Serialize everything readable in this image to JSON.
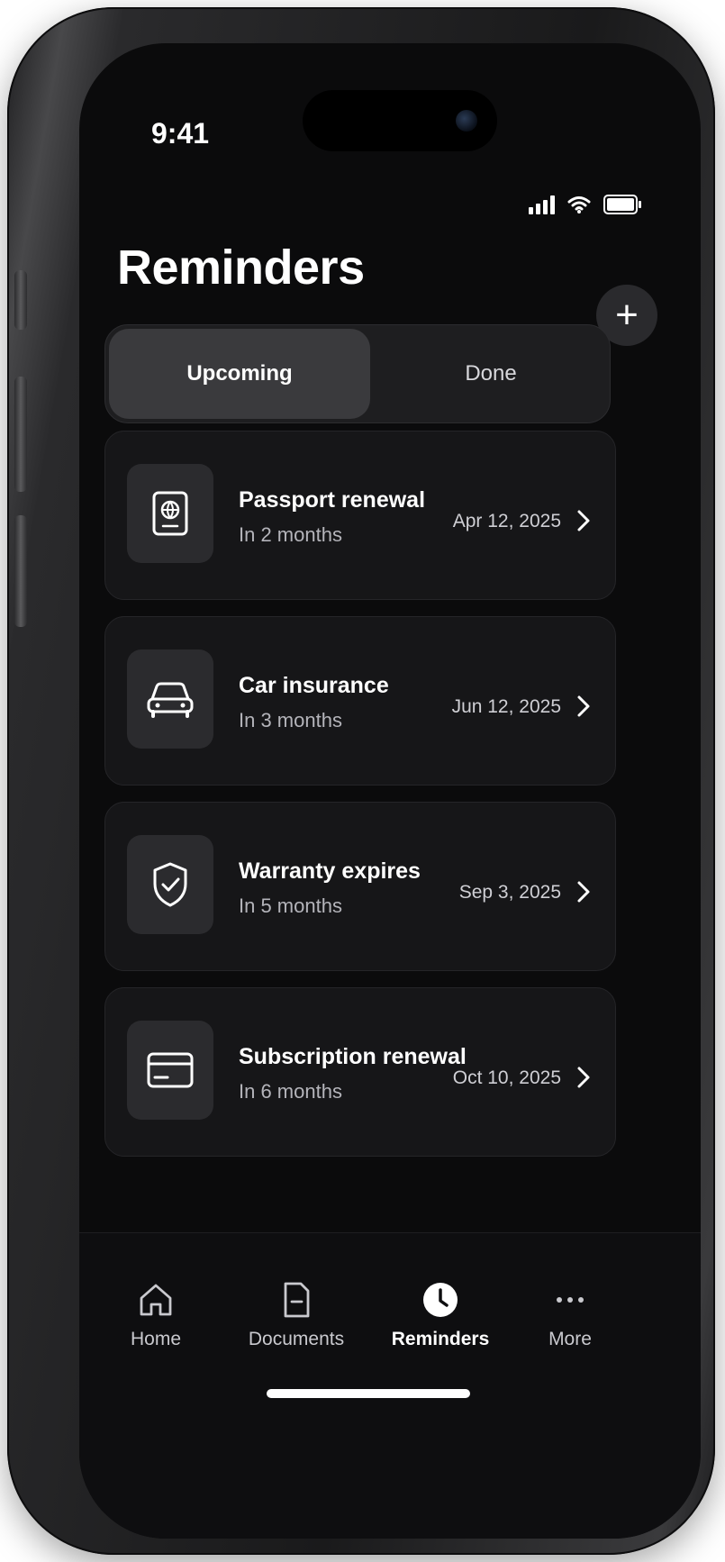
{
  "status": {
    "time": "9:41"
  },
  "header": {
    "title": "Reminders",
    "add_symbol": "+"
  },
  "segments": {
    "upcoming": "Upcoming",
    "done": "Done"
  },
  "reminders": [
    {
      "icon": "passport-icon",
      "title": "Passport renewal",
      "subtitle": "In 2 months",
      "date": "Apr 12, 2025"
    },
    {
      "icon": "car-icon",
      "title": "Car insurance",
      "subtitle": "In 3 months",
      "date": "Jun 12, 2025"
    },
    {
      "icon": "shield-check-icon",
      "title": "Warranty expires",
      "subtitle": "In 5 months",
      "date": "Sep 3, 2025"
    },
    {
      "icon": "credit-card-icon",
      "title": "Subscription renewal",
      "subtitle": "In 6 months",
      "date": "Oct 10, 2025"
    }
  ],
  "tabbar": {
    "home": "Home",
    "documents": "Documents",
    "reminders": "Reminders",
    "more": "More"
  },
  "colors": {
    "background": "#0b0b0c",
    "card": "#161618",
    "active_segment": "#3a3a3d",
    "text": "#ffffff",
    "muted": "#b4b4ba"
  }
}
